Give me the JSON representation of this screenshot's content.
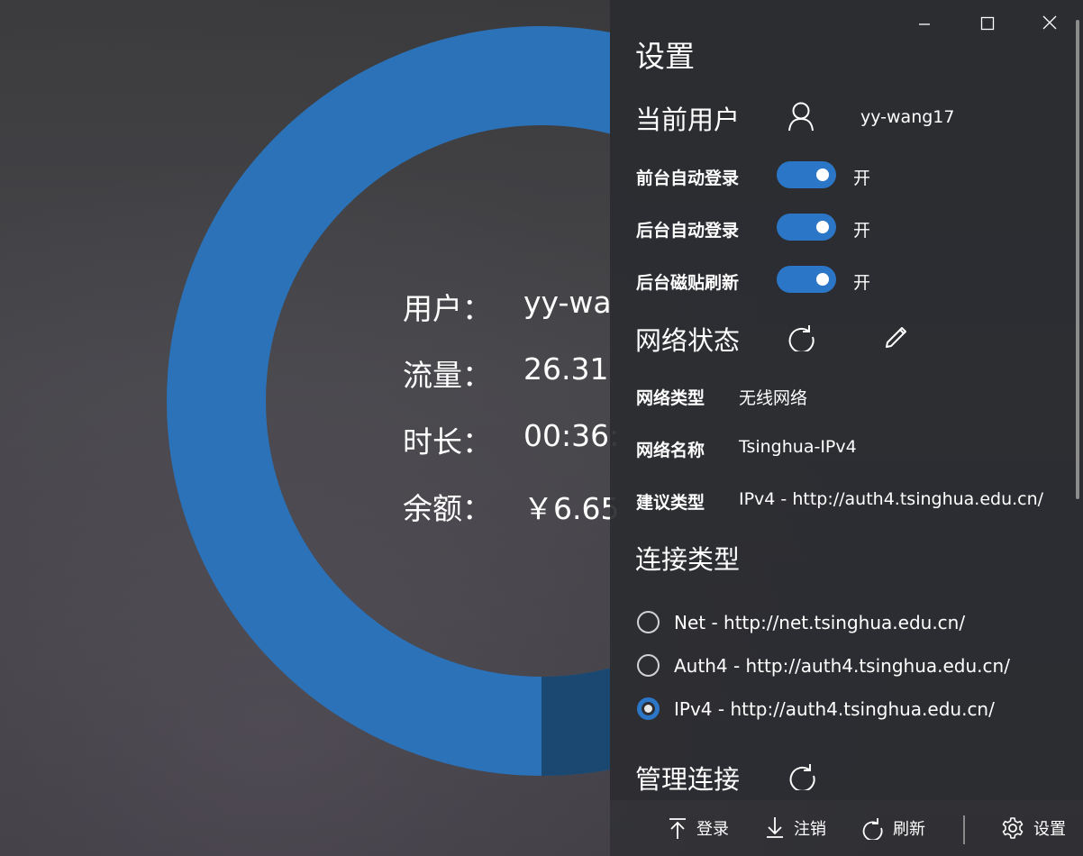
{
  "window": {
    "controls": [
      "minimize",
      "maximize",
      "close"
    ]
  },
  "main": {
    "ring": {
      "used_fraction": 0.93,
      "colors": {
        "track": "#2b72b8",
        "used": "#1b4871"
      }
    },
    "info": [
      {
        "key": "用户：",
        "value": "yy-wa"
      },
      {
        "key": "流量：",
        "value": "26.31"
      },
      {
        "key": "时长：",
        "value": "00:36:"
      },
      {
        "key": "余额：",
        "value": "￥6.65"
      }
    ]
  },
  "settings": {
    "title": "设置",
    "current_user": {
      "label": "当前用户",
      "icon": "person-icon",
      "username": "yy-wang17"
    },
    "toggles": [
      {
        "label": "前台自动登录",
        "state": "开",
        "on": true
      },
      {
        "label": "后台自动登录",
        "state": "开",
        "on": true
      },
      {
        "label": "后台磁贴刷新",
        "state": "开",
        "on": true
      }
    ],
    "network_status": {
      "label": "网络状态",
      "refresh_icon": "refresh-icon",
      "edit_icon": "pencil-icon",
      "rows": [
        {
          "label": "网络类型",
          "value": "无线网络"
        },
        {
          "label": "网络名称",
          "value": "Tsinghua-IPv4"
        },
        {
          "label": "建议类型",
          "value": "IPv4 - http://auth4.tsinghua.edu.cn/"
        }
      ]
    },
    "connection_type": {
      "label": "连接类型",
      "options": [
        {
          "label": "Net - http://net.tsinghua.edu.cn/",
          "selected": false
        },
        {
          "label": "Auth4 - http://auth4.tsinghua.edu.cn/",
          "selected": false
        },
        {
          "label": "IPv4 - http://auth4.tsinghua.edu.cn/",
          "selected": true
        }
      ]
    },
    "manage_connections": {
      "label": "管理连接",
      "refresh_icon": "refresh-icon"
    }
  },
  "commandbar": {
    "login": {
      "label": "登录",
      "icon": "arrow-up-icon"
    },
    "logout": {
      "label": "注销",
      "icon": "arrow-down-icon"
    },
    "refresh": {
      "label": "刷新",
      "icon": "refresh-icon"
    },
    "settings": {
      "label": "设置",
      "icon": "gear-icon"
    }
  },
  "colors": {
    "accent": "#2b76c7"
  }
}
